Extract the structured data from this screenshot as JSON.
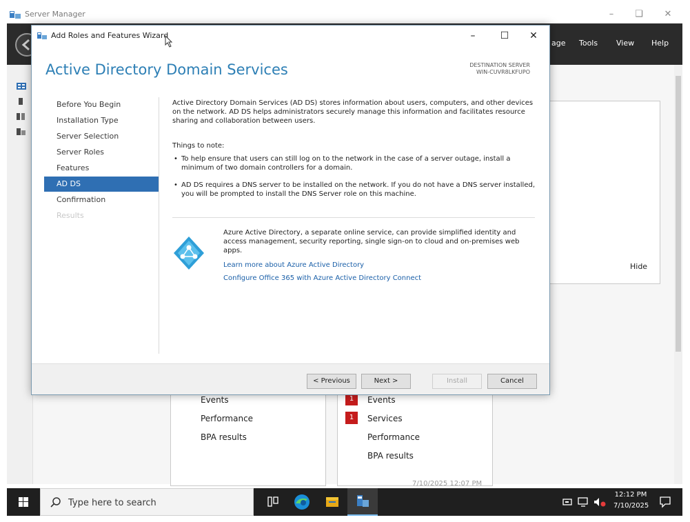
{
  "server_manager": {
    "title": "Server Manager",
    "menu": [
      "age",
      "Tools",
      "View",
      "Help"
    ],
    "hide_label": "Hide",
    "tiles": {
      "left_items": [
        "Events",
        "Performance",
        "BPA results"
      ],
      "right_items": [
        {
          "badge": "1",
          "label": "Events"
        },
        {
          "badge": "1",
          "label": "Services"
        },
        {
          "badge": "",
          "label": "Performance"
        },
        {
          "badge": "",
          "label": "BPA results"
        }
      ],
      "timestamp": "7/10/2025 12:07 PM"
    }
  },
  "wizard": {
    "title": "Add Roles and Features Wizard",
    "heading": "Active Directory Domain Services",
    "destination_label": "DESTINATION SERVER",
    "destination_server": "WIN-CUVR8LKFUPO",
    "nav": [
      {
        "label": "Before You Begin",
        "state": "normal"
      },
      {
        "label": "Installation Type",
        "state": "normal"
      },
      {
        "label": "Server Selection",
        "state": "normal"
      },
      {
        "label": "Server Roles",
        "state": "normal"
      },
      {
        "label": "Features",
        "state": "normal"
      },
      {
        "label": "AD DS",
        "state": "selected"
      },
      {
        "label": "Confirmation",
        "state": "normal"
      },
      {
        "label": "Results",
        "state": "disabled"
      }
    ],
    "description": "Active Directory Domain Services (AD DS) stores information about users, computers, and other devices on the network.  AD DS helps administrators securely manage this information and facilitates resource sharing and collaboration between users.",
    "notes_heading": "Things to note:",
    "notes": [
      "To help ensure that users can still log on to the network in the case of a server outage, install a minimum of two domain controllers for a domain.",
      "AD DS requires a DNS server to be installed on the network.  If you do not have a DNS server installed, you will be prompted to install the DNS Server role on this machine."
    ],
    "azure_text": "Azure Active Directory, a separate online service, can provide simplified identity and access management, security reporting, single sign-on to cloud and on-premises web apps.",
    "azure_links": [
      "Learn more about Azure Active Directory",
      "Configure Office 365 with Azure Active Directory Connect"
    ],
    "buttons": {
      "previous": "< Previous",
      "next": "Next >",
      "install": "Install",
      "cancel": "Cancel"
    }
  },
  "taskbar": {
    "search_placeholder": "Type here to search",
    "time": "12:12 PM",
    "date": "7/10/2025"
  },
  "colors": {
    "accent_blue": "#2d7fb5",
    "nav_selected": "#2f6fb3",
    "link": "#1a5fa8",
    "badge_red": "#c51c1c"
  }
}
